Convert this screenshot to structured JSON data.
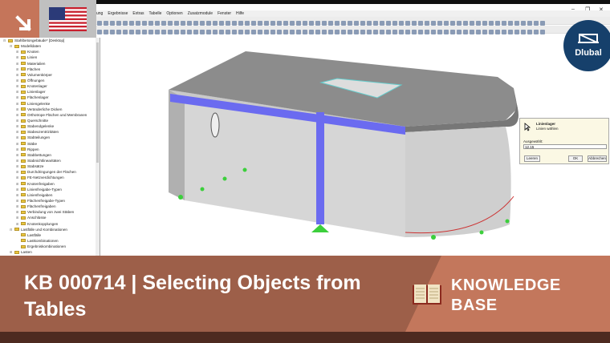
{
  "window": {
    "controls": [
      "–",
      "❐",
      "✕"
    ]
  },
  "menu": [
    "ung",
    "Ergebnisse",
    "Extras",
    "Tabelle",
    "Optionen",
    "Zusatzmodule",
    "Fenster",
    "Hilfe"
  ],
  "tree": {
    "root": "Stahlbetongebäude* [Desktop]",
    "group1": "Modelldaten",
    "items": [
      "Knoten",
      "Linien",
      "Materialien",
      "Flächen",
      "Volumenkörper",
      "Öffnungen",
      "Knotenlager",
      "Linienlager",
      "Flächenlager",
      "Liniengelenke",
      "Veränderliche Dicken",
      "Orthotrope Flächen und Membranen",
      "Querschnitte",
      "Stabendgelenke",
      "Stabexzentrizitäten",
      "Stabteilungen",
      "Stäbe",
      "Rippen",
      "Stabbettungen",
      "Stabnichtlinearitäten",
      "Stabsätze",
      "Durchdringungen der Flächen",
      "FE-Netzverdichtungen",
      "Knotenfreigaben",
      "Linienfreigabe-Typen",
      "Linienfreigaben",
      "Flächenfreigabe-Typen",
      "Flächenfreigaben",
      "Verbindung von zwei Stäben",
      "Anschlüsse",
      "Knotenkopplungen"
    ],
    "group2": "Lastfälle und Kombinationen",
    "items2": [
      "Lastfälle",
      "Lastkombinationen",
      "Ergebniskombinationen"
    ],
    "group3": "Lasten"
  },
  "dialog": {
    "title": "Linienlager",
    "subtitle": "Linien wählen",
    "selected_label": "Ausgewählt:",
    "selected_value": "12,15",
    "clear": "Leeren",
    "ok": "OK",
    "cancel": "Abbrechen"
  },
  "logo": {
    "text": "Dlubal"
  },
  "banner": {
    "title": "KB 000714 | Selecting Objects from Tables",
    "category_line1": "KNOWLEDGE",
    "category_line2": "BASE"
  },
  "colors": {
    "banner_dark": "#9d5f49",
    "banner_light": "#c3775c",
    "strip": "#4e2a20",
    "member": "#6b6bf0",
    "support": "#3ccf3c"
  }
}
